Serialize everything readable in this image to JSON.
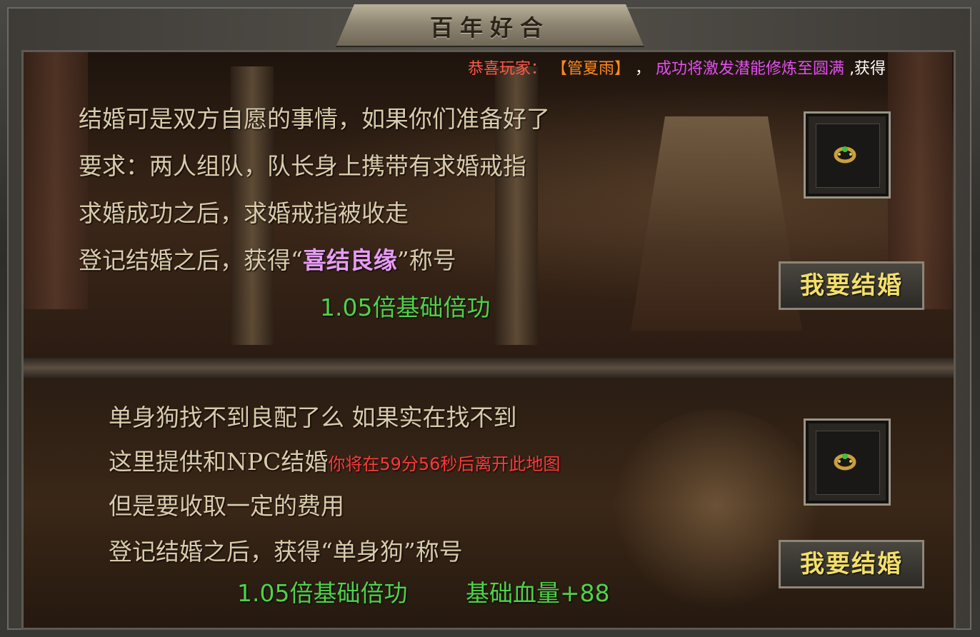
{
  "window": {
    "title": "百年好合"
  },
  "notice": {
    "prefix": "恭喜玩家：",
    "player": "【管夏雨】",
    "comma": "，",
    "message": "成功将激发潜能修炼至圆满",
    "suffix": ",获得"
  },
  "marriage": {
    "line1": "结婚可是双方自愿的事情，如果你们准备好了",
    "line2": "要求：两人组队，队长身上携带有求婚戒指",
    "line3": "求婚成功之后，求婚戒指被收走",
    "line4_pre": "登记结婚之后，获得“",
    "line4_title": "喜结良缘",
    "line4_post": "”称号",
    "bonus": "1.05倍基础倍功",
    "button": "我要结婚",
    "item_icon": "ring-icon"
  },
  "npc": {
    "line1": "单身狗找不到良配了么 如果实在找不到",
    "line2": "这里提供和NPC结婚",
    "timer": "你将在59分56秒后离开此地图",
    "line3": "但是要收取一定的费用",
    "line4": "登记结婚之后，获得“单身狗”称号",
    "bonus1": "1.05倍基础倍功",
    "bonus2": "基础血量+88",
    "button": "我要结婚",
    "item_icon": "ring-icon"
  }
}
